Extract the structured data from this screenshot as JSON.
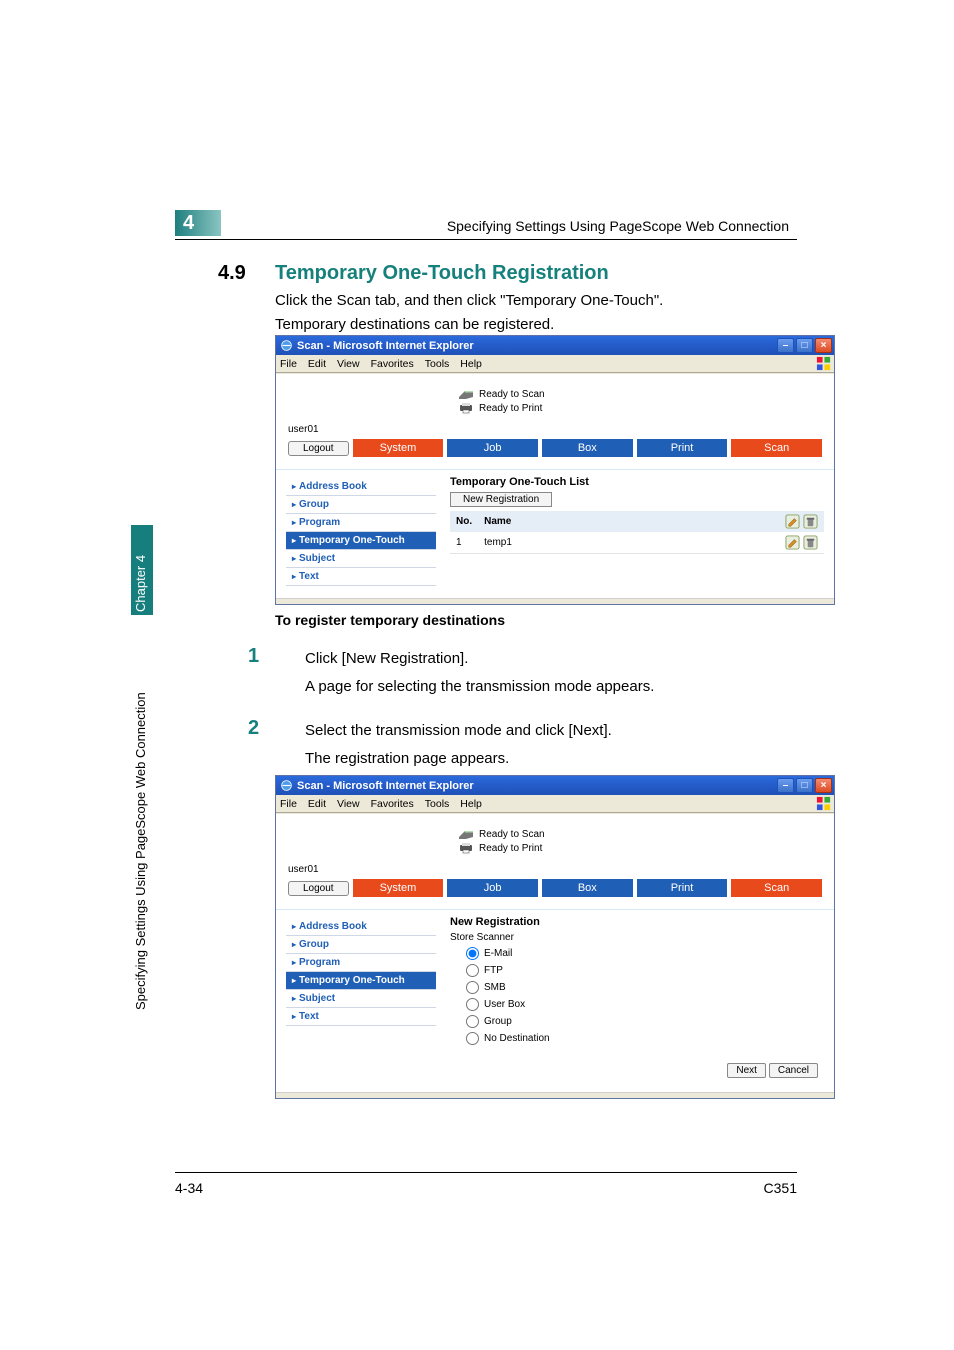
{
  "header": {
    "chapter_badge": "4",
    "breadcrumb": "Specifying Settings Using PageScope Web Connection"
  },
  "section": {
    "number": "4.9",
    "title": "Temporary One-Touch Registration",
    "intro1": "Click the Scan tab, and then click \"Temporary One-Touch\".",
    "intro2": "Temporary destinations can be registered."
  },
  "subheading": "To register temporary destinations",
  "steps": {
    "s1": {
      "num": "1",
      "a": "Click [New Registration].",
      "b": "A page for selecting the transmission mode appears."
    },
    "s2": {
      "num": "2",
      "a": "Select the transmission mode and click [Next].",
      "b": "The registration page appears."
    }
  },
  "ie_common": {
    "title": "Scan - Microsoft Internet Explorer",
    "menus": {
      "file": "File",
      "edit": "Edit",
      "view": "View",
      "favorites": "Favorites",
      "tools": "Tools",
      "help": "Help"
    },
    "status_scan": "Ready to Scan",
    "status_print": "Ready to Print",
    "user": "user01",
    "logout": "Logout",
    "tabs": {
      "system": "System",
      "job": "Job",
      "box": "Box",
      "print": "Print",
      "scan": "Scan"
    },
    "nav": {
      "address_book": "Address Book",
      "group": "Group",
      "program": "Program",
      "temporary": "Temporary One-Touch",
      "subject": "Subject",
      "text": "Text"
    }
  },
  "ie1": {
    "pane_title": "Temporary One-Touch List",
    "new_registration": "New Registration",
    "cols": {
      "no": "No.",
      "name": "Name"
    },
    "rows": [
      {
        "no": "1",
        "name": "temp1"
      }
    ],
    "rowicons": {
      "edit": "edit-icon",
      "delete": "delete-icon"
    },
    "header_row_icons": {
      "edit": "edit-icon",
      "delete": "delete-icon"
    }
  },
  "ie2": {
    "pane_title": "New Registration",
    "store_label": "Store Scanner",
    "options": {
      "email": "E-Mail",
      "ftp": "FTP",
      "smb": "SMB",
      "userbox": "User Box",
      "group": "Group",
      "nodest": "No Destination"
    },
    "selected": "email",
    "next": "Next",
    "cancel": "Cancel"
  },
  "side": {
    "chapter": "Chapter 4",
    "title": "Specifying Settings Using PageScope Web Connection"
  },
  "footer": {
    "left": "4-34",
    "right": "C351"
  }
}
